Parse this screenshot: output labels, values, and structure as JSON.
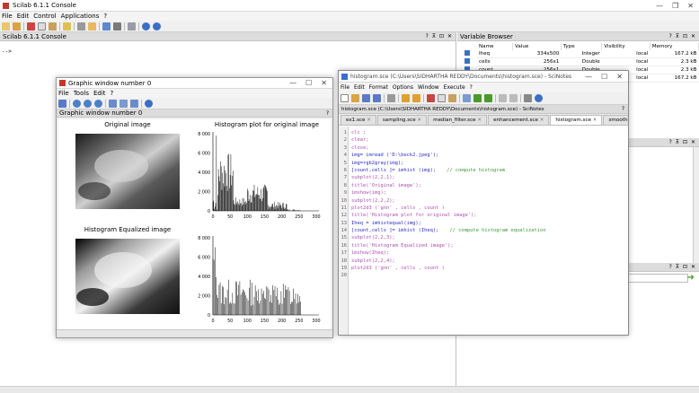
{
  "console": {
    "title": "Scilab 6.1.1 Console",
    "menu": [
      "File",
      "Edit",
      "Control",
      "Applications",
      "?"
    ],
    "panel_title": "Scilab 6.1.1 Console",
    "prompt": "-->"
  },
  "variable_browser": {
    "title": "Variable Browser",
    "columns": [
      "Name",
      "Value",
      "Type",
      "Visibility",
      "Memory"
    ],
    "rows": [
      {
        "name": "Iheq",
        "value": "334x500",
        "type": "Integer",
        "visibility": "local",
        "memory": "167.2 kB"
      },
      {
        "name": "cells",
        "value": "256x1",
        "type": "Double",
        "visibility": "local",
        "memory": "2.3 kB"
      },
      {
        "name": "count",
        "value": "256x1",
        "type": "Double",
        "visibility": "local",
        "memory": "2.3 kB"
      },
      {
        "name": "img",
        "value": "334x500",
        "type": "Integer",
        "visibility": "local",
        "memory": "167.2 kB"
      }
    ]
  },
  "graphic": {
    "title": "Graphic window number 0",
    "menu": [
      "File",
      "Tools",
      "Edit",
      "?"
    ],
    "panel_title": "Graphic window number 0",
    "plots": {
      "original_title": "Original image",
      "hist_title": "Histogram plot for original image",
      "equalized_title": "Histogram Equalized image",
      "hist_yticks": [
        "8 000",
        "6 000",
        "4 000",
        "2 000",
        "0"
      ],
      "hist_yticks2": [
        "8 000",
        "6 000",
        "4 000",
        "2 000",
        "0"
      ],
      "xticks": [
        "0",
        "50",
        "100",
        "150",
        "200",
        "250",
        "300"
      ]
    }
  },
  "scinotes": {
    "title": "histogram.sce (C:\\Users\\SIDHARTHA REDDY\\Documents\\histogram.sce) - SciNotes",
    "menu": [
      "File",
      "Edit",
      "Format",
      "Options",
      "Window",
      "Execute",
      "?"
    ],
    "path": "histogram.sce (C:\\Users\\SIDHARTHA REDDY\\Documents\\histogram.sce) - SciNotes",
    "tabs": [
      "ex1.sce",
      "sampling.sce",
      "median_filter.sce",
      "enhancement.sce",
      "histogram.sce",
      "smoothing.sce"
    ],
    "active_tab": 4,
    "lines": [
      {
        "n": "1",
        "t": "clc ;",
        "k": "kw"
      },
      {
        "n": "2",
        "t": "clear;",
        "k": "kw"
      },
      {
        "n": "3",
        "t": "close;",
        "k": "kw"
      },
      {
        "n": "4",
        "t": "img= imread ('D:\\beck2.jpeg');",
        "k": "fn"
      },
      {
        "n": "5",
        "t": "img=rgb2gray(img);",
        "k": "fn"
      },
      {
        "n": "6",
        "t": "[count,cells ]= imhist (img);",
        "k": "fn",
        "c": "// compute histogram"
      },
      {
        "n": "7",
        "t": "subplot(2,2,1);",
        "k": "kw"
      },
      {
        "n": "8",
        "t": "title('Original image');",
        "k": "kw"
      },
      {
        "n": "9",
        "t": "imshow(img);",
        "k": "kw"
      },
      {
        "n": "10",
        "t": "subplot(2,2,2);",
        "k": "kw"
      },
      {
        "n": "11",
        "t": "plot2d3 ('gnn' , cells , count )",
        "k": "kw"
      },
      {
        "n": "12",
        "t": "title('Histogram plot for original image');",
        "k": "kw"
      },
      {
        "n": "13",
        "t": "Iheq = imhistequal(img);",
        "k": "fn"
      },
      {
        "n": "14",
        "t": "[count,cells ]= imhist (Iheq);",
        "k": "fn",
        "c": "// compute histogram equalization"
      },
      {
        "n": "15",
        "t": "subplot(2,2,3);",
        "k": "kw"
      },
      {
        "n": "16",
        "t": "title('Histogram Equalized image');",
        "k": "kw"
      },
      {
        "n": "17",
        "t": "imshow(Iheq);",
        "k": "kw"
      },
      {
        "n": "18",
        "t": "subplot(2,2,4);",
        "k": "kw"
      },
      {
        "n": "19",
        "t": "plot2d3 ('gnn' , cells , count )",
        "k": "kw"
      },
      {
        "n": "20",
        "t": "",
        "k": "kw"
      }
    ]
  },
  "colors": {
    "keyword": "#b04fb0",
    "function": "#2a2ac8",
    "comment": "#3c9a3c",
    "accent": "#2e6fb7"
  }
}
